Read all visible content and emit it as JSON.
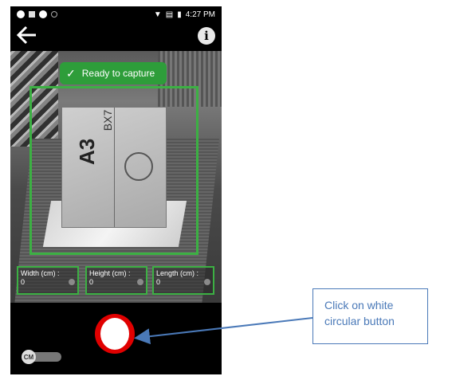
{
  "status_bar": {
    "time": "4:27 PM"
  },
  "camera": {
    "ready_label": "Ready to capture",
    "box_text": "A3",
    "box_sub": "BX7"
  },
  "measurements": [
    {
      "label": "Width (cm) :",
      "value": "0"
    },
    {
      "label": "Height (cm) :",
      "value": "0"
    },
    {
      "label": "Length (cm) :",
      "value": "0"
    }
  ],
  "toggle": {
    "label": "CM"
  },
  "callout": {
    "text": "Click on white circular button"
  },
  "colors": {
    "detect_green": "#3cb043",
    "shutter_ring": "#e00000",
    "callout_blue": "#4a79b8"
  }
}
